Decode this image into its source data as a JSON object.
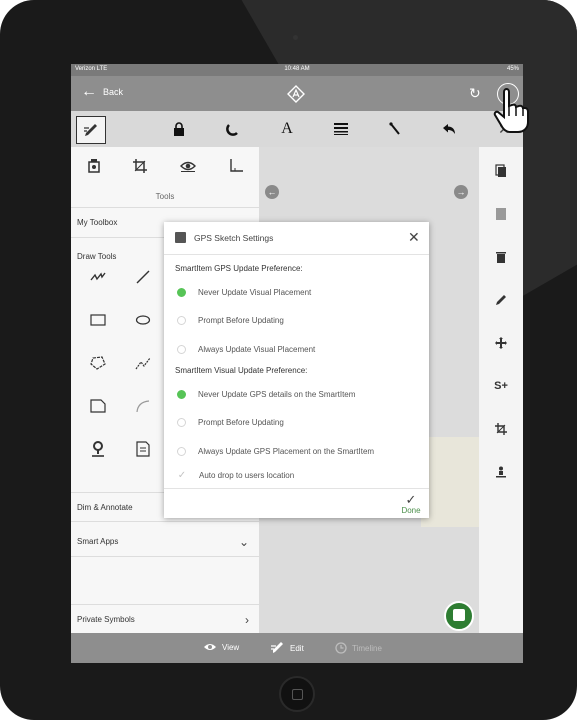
{
  "status": {
    "carrier": "Verizon  LTE",
    "time": "10:48 AM",
    "battery": "45%"
  },
  "nav": {
    "back_label": "Back"
  },
  "left": {
    "tools_label": "Tools",
    "my_toolbox": "My Toolbox",
    "draw_tools": "Draw Tools",
    "dim_annotate": "Dim & Annotate",
    "smart_apps": "Smart Apps",
    "private_symbols": "Private Symbols"
  },
  "modal": {
    "title": "GPS Sketch Settings",
    "gps_pref_label": "SmartItem GPS Update Preference:",
    "gps_options": [
      "Never Update Visual Placement",
      "Prompt Before Updating",
      "Always Update Visual Placement"
    ],
    "gps_selected": 0,
    "visual_pref_label": "SmartItem Visual Update Preference:",
    "visual_options": [
      "Never Update GPS details on the SmartItem",
      "Prompt Before Updating",
      "Always Update GPS Placement on the SmartItem"
    ],
    "visual_selected": 0,
    "auto_drop": "Auto drop to users location",
    "done_label": "Done"
  },
  "bottom": {
    "view": "View",
    "edit": "Edit",
    "timeline": "Timeline"
  },
  "colors": {
    "accent_green": "#57c457",
    "fab_green": "#2e7d32"
  }
}
